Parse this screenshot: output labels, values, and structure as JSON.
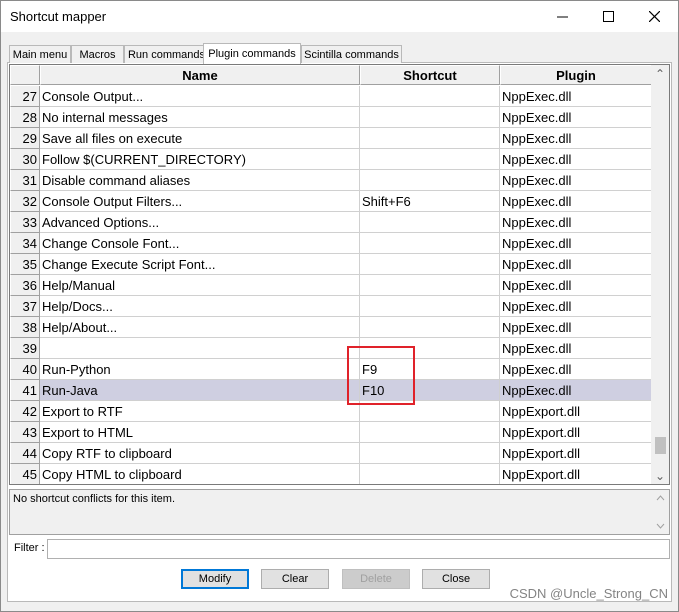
{
  "window": {
    "title": "Shortcut mapper",
    "minimize_glyph": "─",
    "maximize_glyph": "☐",
    "close_glyph": "✕"
  },
  "tabs": [
    {
      "label": "Main menu",
      "active": false
    },
    {
      "label": "Macros",
      "active": false
    },
    {
      "label": "Run commands",
      "active": false
    },
    {
      "label": "Plugin commands",
      "active": true
    },
    {
      "label": "Scintilla commands",
      "active": false
    }
  ],
  "table": {
    "columns": [
      "",
      "Name",
      "Shortcut",
      "Plugin"
    ],
    "selected_row": "41",
    "rows": [
      {
        "num": "27",
        "name": "Console Output...",
        "shortcut": "",
        "plugin": "NppExec.dll"
      },
      {
        "num": "28",
        "name": "No internal messages",
        "shortcut": "",
        "plugin": "NppExec.dll"
      },
      {
        "num": "29",
        "name": "Save all files on execute",
        "shortcut": "",
        "plugin": "NppExec.dll"
      },
      {
        "num": "30",
        "name": "Follow $(CURRENT_DIRECTORY)",
        "shortcut": "",
        "plugin": "NppExec.dll"
      },
      {
        "num": "31",
        "name": "Disable command aliases",
        "shortcut": "",
        "plugin": "NppExec.dll"
      },
      {
        "num": "32",
        "name": "Console Output Filters...",
        "shortcut": "Shift+F6",
        "plugin": "NppExec.dll"
      },
      {
        "num": "33",
        "name": "Advanced Options...",
        "shortcut": "",
        "plugin": "NppExec.dll"
      },
      {
        "num": "34",
        "name": "Change Console Font...",
        "shortcut": "",
        "plugin": "NppExec.dll"
      },
      {
        "num": "35",
        "name": "Change Execute Script Font...",
        "shortcut": "",
        "plugin": "NppExec.dll"
      },
      {
        "num": "36",
        "name": "Help/Manual",
        "shortcut": "",
        "plugin": "NppExec.dll"
      },
      {
        "num": "37",
        "name": "Help/Docs...",
        "shortcut": "",
        "plugin": "NppExec.dll"
      },
      {
        "num": "38",
        "name": "Help/About...",
        "shortcut": "",
        "plugin": "NppExec.dll"
      },
      {
        "num": "39",
        "name": "",
        "shortcut": "",
        "plugin": "NppExec.dll"
      },
      {
        "num": "40",
        "name": "Run-Python",
        "shortcut": "F9",
        "plugin": "NppExec.dll"
      },
      {
        "num": "41",
        "name": "Run-Java",
        "shortcut": "F10",
        "plugin": "NppExec.dll"
      },
      {
        "num": "42",
        "name": "Export to RTF",
        "shortcut": "",
        "plugin": "NppExport.dll"
      },
      {
        "num": "43",
        "name": "Export to HTML",
        "shortcut": "",
        "plugin": "NppExport.dll"
      },
      {
        "num": "44",
        "name": "Copy RTF to clipboard",
        "shortcut": "",
        "plugin": "NppExport.dll"
      },
      {
        "num": "45",
        "name": "Copy HTML to clipboard",
        "shortcut": "",
        "plugin": "NppExport.dll"
      }
    ]
  },
  "scrollbar": {
    "up_glyph": "⌃",
    "down_glyph": "⌄"
  },
  "conflict_message": "No shortcut conflicts for this item.",
  "filter": {
    "label": "Filter :",
    "value": ""
  },
  "buttons": {
    "modify": "Modify",
    "clear": "Clear",
    "delete": "Delete",
    "close": "Close"
  },
  "watermark": "CSDN @Uncle_Strong_CN",
  "colors": {
    "selected_row": "#cfcfe1",
    "annotation_box": "#e0222a",
    "default_button_border": "#0078d7"
  }
}
